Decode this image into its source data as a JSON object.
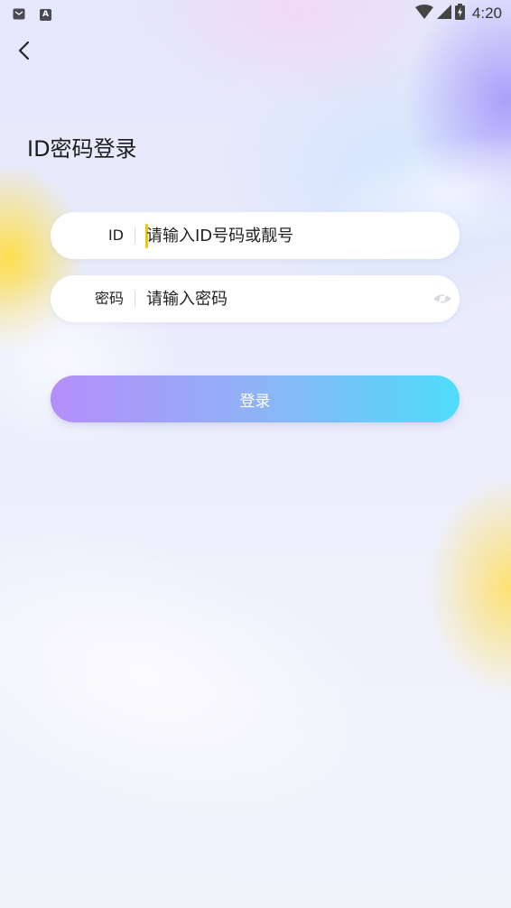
{
  "status_bar": {
    "time": "4:20",
    "left_icons": [
      "notification-icon",
      "app-a-icon"
    ],
    "app_icon_letter": "A",
    "right_icons": [
      "wifi-icon",
      "cellular-signal-icon",
      "battery-charging-icon"
    ]
  },
  "nav": {
    "back_icon": "chevron-left-icon"
  },
  "page": {
    "title": "ID密码登录"
  },
  "form": {
    "id_field": {
      "label": "ID",
      "value": "",
      "placeholder": "请输入ID号码或靓号"
    },
    "password_field": {
      "label": "密码",
      "value": "",
      "placeholder": "请输入密码",
      "toggle_icon": "eye-icon"
    },
    "submit_label": "登录"
  },
  "colors": {
    "button_gradient_start": "#b58efa",
    "button_gradient_end": "#4fdcf9",
    "caret": "#f5c400"
  }
}
